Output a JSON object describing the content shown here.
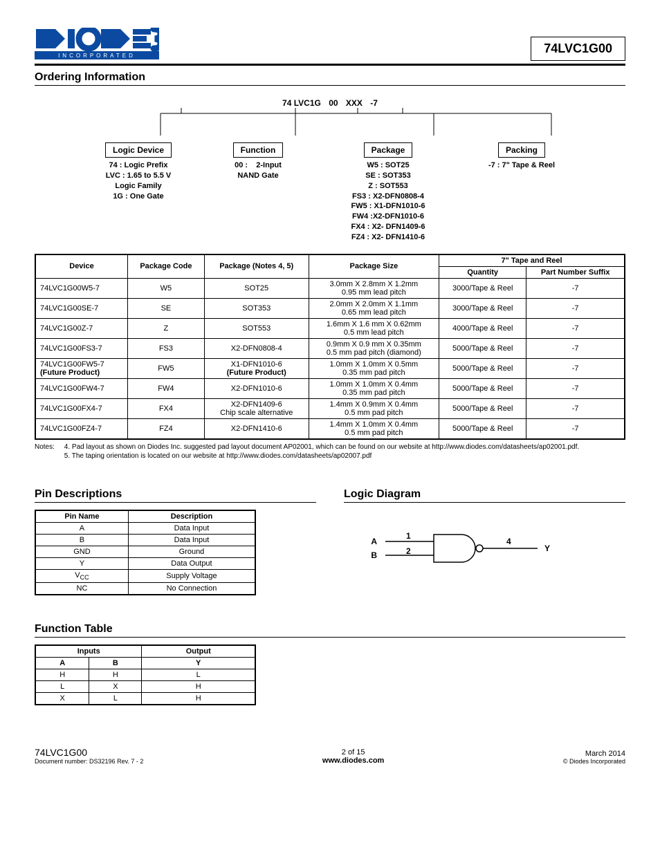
{
  "header": {
    "logo_tag": "INCORPORATED",
    "part_number": "74LVC1G00"
  },
  "sections": {
    "ordering": "Ordering Information",
    "pins": "Pin Descriptions",
    "logic": "Logic Diagram",
    "func": "Function Table"
  },
  "ordering_code": {
    "seg1": "74 LVC1G",
    "seg2": "00",
    "seg3": "XXX",
    "seg4": "-7",
    "columns": [
      {
        "title": "Logic Device",
        "lines": [
          "74 : Logic Prefix",
          "LVC : 1.65 to 5.5 V",
          "Logic Family",
          "1G : One Gate"
        ]
      },
      {
        "title": "Function",
        "lines": [
          "00 :    2-Input",
          "NAND Gate"
        ]
      },
      {
        "title": "Package",
        "lines": [
          "W5 : SOT25",
          "SE : SOT353",
          "Z : SOT553",
          "FS3 : X2-DFN0808-4",
          "FW5 : X1-DFN1010-6",
          "FW4 :X2-DFN1010-6",
          "FX4 : X2- DFN1409-6",
          "FZ4 : X2- DFN1410-6"
        ]
      },
      {
        "title": "Packing",
        "lines": [
          "-7 : 7\" Tape & Reel"
        ]
      }
    ]
  },
  "ord_table": {
    "headers": {
      "device": "Device",
      "pkg_code": "Package Code",
      "pkg": "Package (Notes 4, 5)",
      "pkg_size": "Package Size",
      "tape": "7\" Tape and Reel",
      "qty": "Quantity",
      "suffix": "Part Number Suffix"
    },
    "rows": [
      {
        "device": "74LVC1G00W5-7",
        "code": "W5",
        "pkg": "SOT25",
        "size": [
          "3.0mm X 2.8mm X 1.2mm",
          "0.95 mm lead pitch"
        ],
        "qty": "3000/Tape & Reel",
        "suf": "-7"
      },
      {
        "device": "74LVC1G00SE-7",
        "code": "SE",
        "pkg": "SOT353",
        "size": [
          "2.0mm X 2.0mm X 1.1mm",
          "0.65 mm lead pitch"
        ],
        "qty": "3000/Tape & Reel",
        "suf": "-7"
      },
      {
        "device": "74LVC1G00Z-7",
        "code": "Z",
        "pkg": "SOT553",
        "size": [
          "1.6mm X 1.6 mm X 0.62mm",
          "0.5 mm lead pitch"
        ],
        "qty": "4000/Tape & Reel",
        "suf": "-7"
      },
      {
        "device": "74LVC1G00FS3-7",
        "code": "FS3",
        "pkg": "X2-DFN0808-4",
        "size": [
          "0.9mm X 0.9 mm X 0.35mm",
          "0.5 mm pad pitch (diamond)"
        ],
        "qty": "5000/Tape & Reel",
        "suf": "-7"
      },
      {
        "device": "74LVC1G00FW5-7\n(Future Product)",
        "code": "FW5",
        "pkg": "X1-DFN1010-6\n(Future Product)",
        "size": [
          "1.0mm X 1.0mm X 0.5mm",
          "0.35 mm pad pitch"
        ],
        "qty": "5000/Tape & Reel",
        "suf": "-7"
      },
      {
        "device": "74LVC1G00FW4-7",
        "code": "FW4",
        "pkg": "X2-DFN1010-6",
        "size": [
          "1.0mm X 1.0mm X 0.4mm",
          "0.35 mm pad pitch"
        ],
        "qty": "5000/Tape & Reel",
        "suf": "-7"
      },
      {
        "device": "74LVC1G00FX4-7",
        "code": "FX4",
        "pkg": "X2-DFN1409-6\nChip scale alternative",
        "size": [
          "1.4mm X 0.9mm X 0.4mm",
          "0.5 mm pad pitch"
        ],
        "qty": "5000/Tape & Reel",
        "suf": "-7"
      },
      {
        "device": "74LVC1G00FZ4-7",
        "code": "FZ4",
        "pkg": "X2-DFN1410-6",
        "size": [
          "1.4mm X 1.0mm X 0.4mm",
          "0.5 mm pad pitch"
        ],
        "qty": "5000/Tape & Reel",
        "suf": "-7"
      }
    ],
    "notes_label": "Notes:",
    "notes": [
      "4. Pad layout as shown on Diodes Inc. suggested pad layout document AP02001, which can be found on our website at http://www.diodes.com/datasheets/ap02001.pdf.",
      "5. The taping orientation is located on our website at http://www.diodes.com/datasheets/ap02007.pdf"
    ]
  },
  "pin_table": {
    "headers": {
      "name": "Pin Name",
      "desc": "Description"
    },
    "rows": [
      {
        "name": "A",
        "desc": "Data Input"
      },
      {
        "name": "B",
        "desc": "Data Input"
      },
      {
        "name": "GND",
        "desc": "Ground"
      },
      {
        "name": "Y",
        "desc": "Data Output"
      },
      {
        "name": "Vcc",
        "desc": "Supply Voltage"
      },
      {
        "name": "NC",
        "desc": "No Connection"
      }
    ]
  },
  "logic_diagram": {
    "A": "A",
    "B": "B",
    "Y": "Y",
    "pin1": "1",
    "pin2": "2",
    "pin4": "4"
  },
  "func_table": {
    "inputs": "Inputs",
    "output": "Output",
    "A": "A",
    "B": "B",
    "Y": "Y",
    "rows": [
      {
        "a": "H",
        "b": "H",
        "y": "L"
      },
      {
        "a": "L",
        "b": "X",
        "y": "H"
      },
      {
        "a": "X",
        "b": "L",
        "y": "H"
      }
    ]
  },
  "footer": {
    "left1": "74LVC1G00",
    "left2": "Document number: DS32196 Rev. 7 - 2",
    "mid1": "2 of 15",
    "mid2": "www.diodes.com",
    "right1": "March 2014",
    "right2": "© Diodes Incorporated"
  }
}
